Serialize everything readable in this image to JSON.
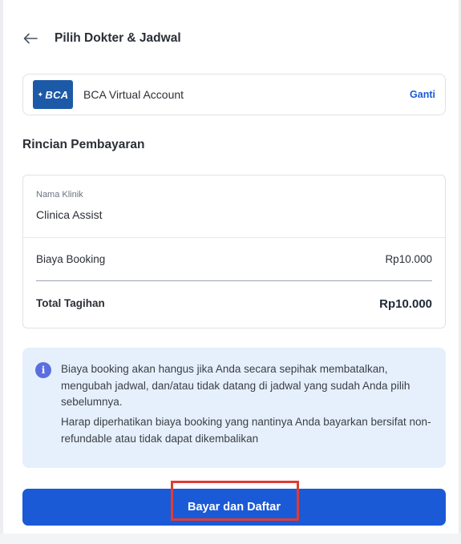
{
  "header": {
    "title": "Pilih Dokter & Jadwal",
    "back_icon": "arrow-left-icon"
  },
  "payment_method": {
    "logo_text": "BCA",
    "name": "BCA Virtual Account",
    "change_label": "Ganti",
    "brand_color": "#1c5aa8"
  },
  "payment_details": {
    "section_title": "Rincian Pembayaran",
    "clinic_label": "Nama Klinik",
    "clinic_name": "Clinica Assist",
    "booking_label": "Biaya Booking",
    "booking_amount": "Rp10.000",
    "total_label": "Total Tagihan",
    "total_amount": "Rp10.000"
  },
  "info": {
    "icon": "info-icon",
    "paragraph_1": "Biaya booking akan hangus jika Anda secara sepihak membatalkan, mengubah jadwal, dan/atau tidak datang di jadwal yang sudah Anda pilih sebelumnya.",
    "paragraph_2": "Harap diperhatikan biaya booking yang nantinya Anda bayarkan bersifat non-refundable atau tidak dapat dikembalikan",
    "background_color": "#e6f0fc"
  },
  "action": {
    "pay_label": "Bayar dan Daftar",
    "button_color": "#1a5ad6",
    "highlight_color": "#e03c33"
  }
}
